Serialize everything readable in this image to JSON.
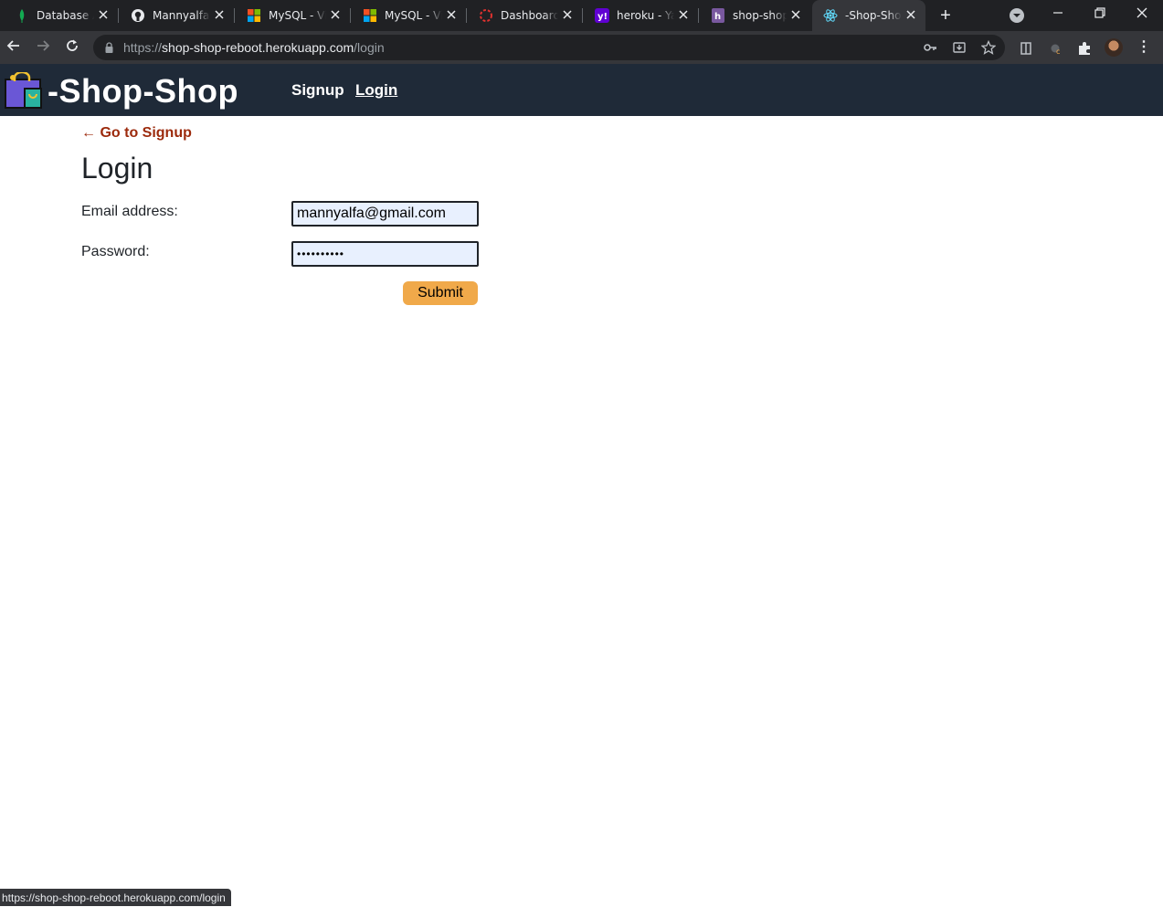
{
  "browser": {
    "tabs": [
      {
        "title": "Database Access",
        "icon": "mongodb-leaf-icon",
        "color": "#13aa52"
      },
      {
        "title": "Mannyalfa/shop-shop",
        "icon": "github-icon",
        "color": "#e8eaed"
      },
      {
        "title": "MySQL - Visual Studio",
        "icon": "microsoft-icon",
        "color": "#f25022"
      },
      {
        "title": "MySQL - Visual Studio",
        "icon": "microsoft-icon",
        "color": "#f25022"
      },
      {
        "title": "Dashboard",
        "icon": "dashboard-ring-icon",
        "color": "#e0322f"
      },
      {
        "title": "heroku - Yahoo Search",
        "icon": "yahoo-icon",
        "color": "#6001d2"
      },
      {
        "title": "shop-shop-reboot",
        "icon": "heroku-icon",
        "color": "#79589f"
      },
      {
        "title": "-Shop-Shop",
        "icon": "react-icon",
        "color": "#61dafb"
      }
    ],
    "url": {
      "scheme": "https://",
      "host": "shop-shop-reboot.herokuapp.com",
      "path": "/login"
    },
    "status_url": "https://shop-shop-reboot.herokuapp.com/login"
  },
  "site": {
    "brand": "-Shop-Shop",
    "nav": {
      "signup": "Signup",
      "login": "Login"
    }
  },
  "login": {
    "back_link": "← Go to Signup",
    "title": "Login",
    "email_label": "Email address:",
    "email_value": "mannyalfa@gmail.com",
    "password_label": "Password:",
    "password_value": "••••••••••",
    "submit_label": "Submit"
  },
  "colors": {
    "header_bg": "#1f2a38",
    "back_link": "#9c2a0c",
    "submit_bg": "#f0a94a",
    "input_bg": "#e8f0fe"
  }
}
